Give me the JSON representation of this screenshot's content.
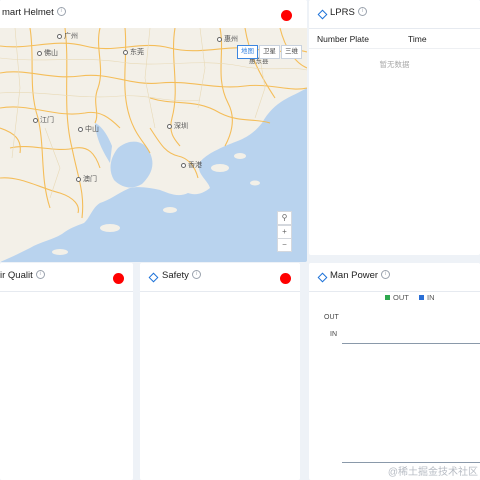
{
  "map_panel": {
    "title": "mart Helmet",
    "status_color": "#ff0000",
    "map_types": [
      "地图",
      "卫星",
      "三维"
    ],
    "cities": [
      "广州",
      "佛山",
      "东莞",
      "惠州",
      "惠东县",
      "江门",
      "中山",
      "深圳",
      "香港",
      "澳门"
    ],
    "controls": [
      "⚲",
      "+",
      "−"
    ]
  },
  "lprs_panel": {
    "title": "LPRS",
    "columns": [
      "Number Plate",
      "Time"
    ],
    "empty_text": "暂无数据"
  },
  "air_panel": {
    "title": "ir Qualit",
    "status_color": "#ff0000"
  },
  "safety_panel": {
    "title": "Safety",
    "status_color": "#ff0000"
  },
  "man_power_panel": {
    "title": "Man Power",
    "legend": [
      {
        "name": "OUT",
        "color": "#2fa84f"
      },
      {
        "name": "IN",
        "color": "#2a6fd6"
      }
    ],
    "y_labels": [
      "OUT",
      "IN"
    ]
  },
  "watermark": "@稀土掘金技术社区"
}
